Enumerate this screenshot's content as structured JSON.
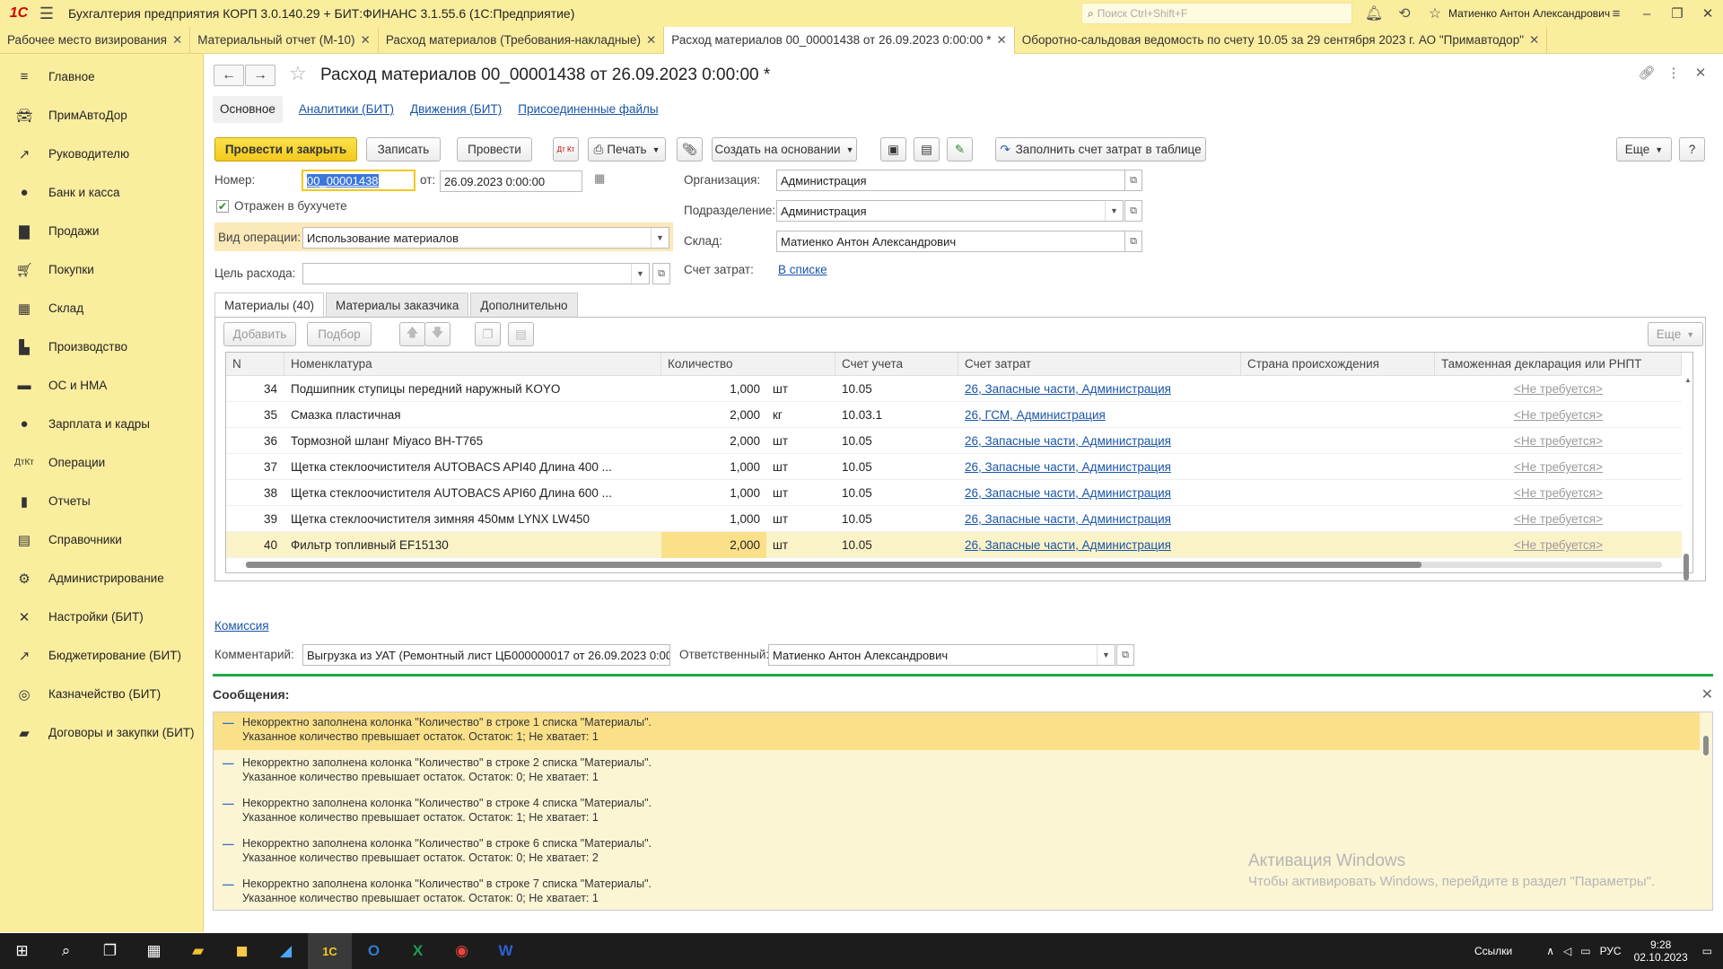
{
  "app": {
    "title": "Бухгалтерия предприятия КОРП 3.0.140.29 + БИТ:ФИНАНС 3.1.55.6  (1С:Предприятие)",
    "logo": "1С",
    "search_placeholder": "Поиск Ctrl+Shift+F",
    "user": "Матиенко Антон Александрович"
  },
  "tabs": [
    {
      "label": "Рабочее место визирования"
    },
    {
      "label": "Материальный отчет (М-10)"
    },
    {
      "label": "Расход материалов (Требования-накладные)"
    },
    {
      "label": "Расход материалов 00_00001438 от 26.09.2023 0:00:00 *"
    },
    {
      "label": "Оборотно-сальдовая ведомость по счету 10.05 за 29 сентября 2023 г. АО \"Примавтодор\""
    }
  ],
  "sidebar": [
    {
      "label": "Главное",
      "icon": "menu-icon"
    },
    {
      "label": "ПримАвтоДор",
      "icon": "car-icon"
    },
    {
      "label": "Руководителю",
      "icon": "trend-icon"
    },
    {
      "label": "Банк и касса",
      "icon": "coin-icon"
    },
    {
      "label": "Продажи",
      "icon": "bag-icon"
    },
    {
      "label": "Покупки",
      "icon": "cart-icon"
    },
    {
      "label": "Склад",
      "icon": "warehouse-icon"
    },
    {
      "label": "Производство",
      "icon": "factory-icon"
    },
    {
      "label": "ОС и НМА",
      "icon": "truck-icon"
    },
    {
      "label": "Зарплата и кадры",
      "icon": "person-icon"
    },
    {
      "label": "Операции",
      "icon": "dt-kt-icon"
    },
    {
      "label": "Отчеты",
      "icon": "chart-icon"
    },
    {
      "label": "Справочники",
      "icon": "book-icon"
    },
    {
      "label": "Администрирование",
      "icon": "gear-icon"
    },
    {
      "label": "Настройки (БИТ)",
      "icon": "tools-icon"
    },
    {
      "label": "Бюджетирование (БИТ)",
      "icon": "budget-icon"
    },
    {
      "label": "Казначейство (БИТ)",
      "icon": "coins-icon"
    },
    {
      "label": "Договоры и закупки (БИТ)",
      "icon": "folder-icon"
    }
  ],
  "document": {
    "title": "Расход материалов 00_00001438 от 26.09.2023 0:00:00 *",
    "subtabs": [
      "Основное",
      "Аналитики (БИТ)",
      "Движения (БИТ)",
      "Присоединенные файлы"
    ],
    "toolbar": {
      "post_close": "Провести и закрыть",
      "save": "Записать",
      "post": "Провести",
      "print": "Печать",
      "create_based": "Создать на основании",
      "fill_cost": "Заполнить счет затрат в таблице",
      "more": "Еще",
      "help": "?",
      "dtkt": "Дт Кт"
    },
    "fields": {
      "number_label": "Номер:",
      "number": "00_00001438",
      "date_label": "от:",
      "date": "26.09.2023  0:00:00",
      "reflected": "Отражен в бухучете",
      "optype_label": "Вид операции:",
      "optype": "Использование материалов",
      "purpose_label": "Цель расхода:",
      "purpose": "",
      "org_label": "Организация:",
      "org": "Администрация",
      "dept_label": "Подразделение:",
      "dept": "Администрация",
      "warehouse_label": "Склад:",
      "warehouse": "Матиенко Антон Александрович",
      "cost_account_label": "Счет затрат:",
      "cost_account": "В списке"
    },
    "form_tabs": [
      "Материалы (40)",
      "Материалы заказчика",
      "Дополнительно"
    ],
    "table_toolbar": {
      "add": "Добавить",
      "pick": "Подбор",
      "more": "Еще"
    },
    "table": {
      "headers": [
        "N",
        "Номенклатура",
        "Количество",
        "Счет учета",
        "Счет затрат",
        "Страна происхождения",
        "Таможенная декларация или РНПТ"
      ],
      "rows": [
        {
          "n": "34",
          "name": "Подшипник ступицы передний наружный KOYO",
          "qty": "1,000",
          "unit": "шт",
          "account": "10.05",
          "cost": "26, Запасные части, Администрация",
          "country": "",
          "decl": "<Не требуется>"
        },
        {
          "n": "35",
          "name": "Смазка пластичная",
          "qty": "2,000",
          "unit": "кг",
          "account": "10.03.1",
          "cost": "26, ГСМ, Администрация",
          "country": "",
          "decl": "<Не требуется>"
        },
        {
          "n": "36",
          "name": "Тормозной шланг Miyaco BH-T765",
          "qty": "2,000",
          "unit": "шт",
          "account": "10.05",
          "cost": "26, Запасные части, Администрация",
          "country": "",
          "decl": "<Не требуется>"
        },
        {
          "n": "37",
          "name": "Щетка стеклоочистителя AUTOBACS API40 Длина 400 ...",
          "qty": "1,000",
          "unit": "шт",
          "account": "10.05",
          "cost": "26, Запасные части, Администрация",
          "country": "",
          "decl": "<Не требуется>"
        },
        {
          "n": "38",
          "name": "Щетка стеклоочистителя AUTOBACS API60 Длина 600 ...",
          "qty": "1,000",
          "unit": "шт",
          "account": "10.05",
          "cost": "26, Запасные части, Администрация",
          "country": "",
          "decl": "<Не требуется>"
        },
        {
          "n": "39",
          "name": "Щетка стеклоочистителя зимняя 450мм LYNX LW450",
          "qty": "1,000",
          "unit": "шт",
          "account": "10.05",
          "cost": "26, Запасные части, Администрация",
          "country": "",
          "decl": "<Не требуется>"
        },
        {
          "n": "40",
          "name": "Фильтр топливный  EF15130",
          "qty": "2,000",
          "unit": "шт",
          "account": "10.05",
          "cost": "26, Запасные части, Администрация",
          "country": "",
          "decl": "<Не требуется>"
        }
      ]
    },
    "commission": "Комиссия",
    "comment_label": "Комментарий:",
    "comment": "Выгрузка из УАТ (Ремонтный лист ЦБ000000017 от 26.09.2023 0:00",
    "responsible_label": "Ответственный:",
    "responsible": "Матиенко Антон Александрович"
  },
  "messages": {
    "title": "Сообщения:",
    "items": [
      {
        "line1": "Некорректно заполнена колонка \"Количество\" в строке 1 списка \"Материалы\".",
        "line2": "Указанное количество превышает остаток. Остаток: 1; Не хватает: 1"
      },
      {
        "line1": "Некорректно заполнена колонка \"Количество\" в строке 2 списка \"Материалы\".",
        "line2": "Указанное количество превышает остаток. Остаток: 0; Не хватает: 1"
      },
      {
        "line1": "Некорректно заполнена колонка \"Количество\" в строке 4 списка \"Материалы\".",
        "line2": "Указанное количество превышает остаток. Остаток: 1; Не хватает: 1"
      },
      {
        "line1": "Некорректно заполнена колонка \"Количество\" в строке 6 списка \"Материалы\".",
        "line2": "Указанное количество превышает остаток. Остаток: 0; Не хватает: 2"
      },
      {
        "line1": "Некорректно заполнена колонка \"Количество\" в строке 7 списка \"Материалы\".",
        "line2": "Указанное количество превышает остаток. Остаток: 0; Не хватает: 1"
      }
    ]
  },
  "watermark": {
    "line1": "Активация Windows",
    "line2": "Чтобы активировать Windows, перейдите в раздел \"Параметры\"."
  },
  "taskbar": {
    "links": "Ссылки",
    "lang": "РУС",
    "time": "9:28",
    "date": "02.10.2023"
  },
  "colors": {
    "accent_yellow": "#fbed9e",
    "primary_button": "#f3c91c",
    "link": "#1a55a8",
    "message_bar": "#23a64a"
  }
}
